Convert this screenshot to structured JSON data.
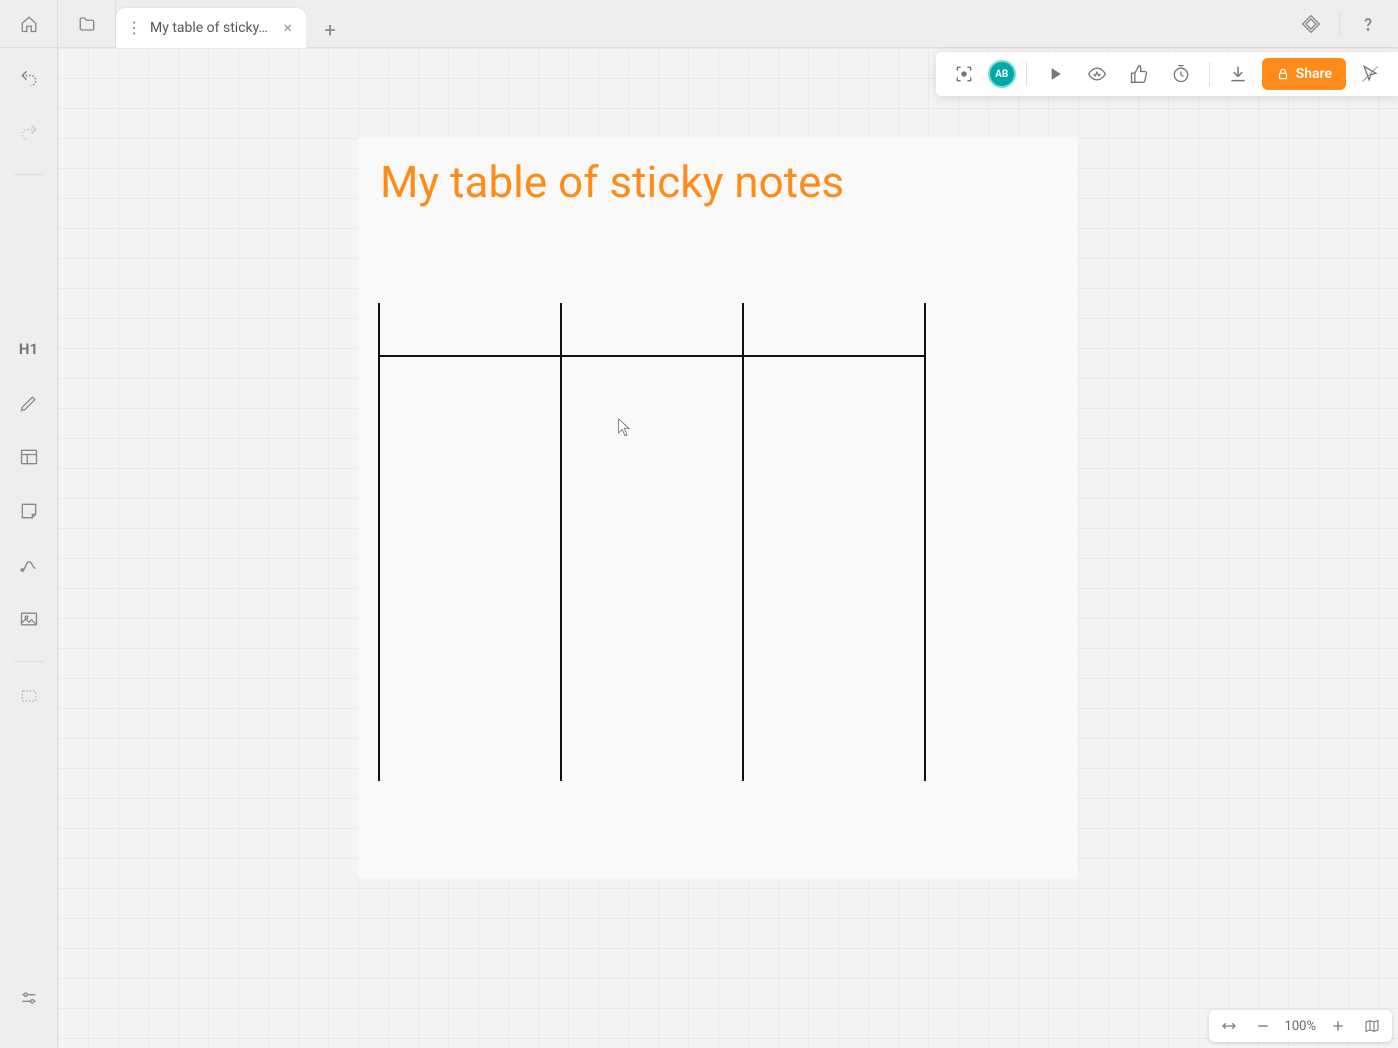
{
  "header": {
    "tab_title": "My table of sticky…",
    "avatar_initials": "AB",
    "share_label": "Share"
  },
  "canvas": {
    "frame_title": "My table of sticky notes"
  },
  "zoom": {
    "level": "100%"
  },
  "icons": {
    "home": "home-icon",
    "folder": "folder-icon",
    "close": "close-icon",
    "plus": "plus-icon",
    "diamond": "diamond-icon",
    "help": "help-icon",
    "undo": "undo-icon",
    "redo": "redo-icon",
    "h1": "H1",
    "pen": "pen-icon",
    "layout": "layout-icon",
    "sticky": "sticky-icon",
    "line": "line-icon",
    "image": "image-icon",
    "more": "more-icon",
    "settings": "settings-icon",
    "focus": "focus-icon",
    "play": "play-icon",
    "eye": "eye-icon",
    "thumbsup": "thumbsup-icon",
    "timer": "timer-icon",
    "download": "download-icon",
    "lock": "lock-icon",
    "pointer": "pointer-icon",
    "fit": "fit-icon",
    "minus": "minus-icon",
    "plus2": "plus-icon",
    "map": "map-icon"
  }
}
